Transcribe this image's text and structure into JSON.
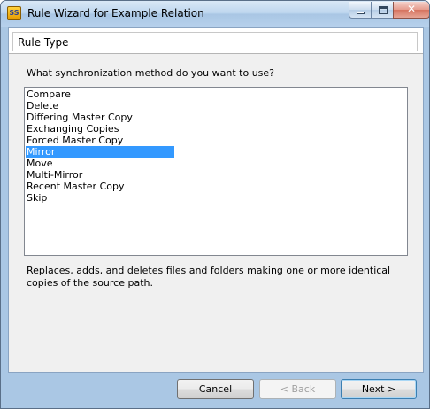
{
  "window": {
    "title": "Rule Wizard for Example Relation",
    "app_icon_text": "SS"
  },
  "header": {
    "title": "Rule Type"
  },
  "main": {
    "prompt": "What synchronization method do you want to use?",
    "methods": [
      "Compare",
      "Delete",
      "Differing Master Copy",
      "Exchanging Copies",
      "Forced Master Copy",
      "Mirror",
      "Move",
      "Multi-Mirror",
      "Recent Master Copy",
      "Skip"
    ],
    "selected_method": "Mirror",
    "description": "Replaces, adds, and deletes files and folders making one or more identical copies of the source path."
  },
  "footer": {
    "cancel_label": "Cancel",
    "back_label": "< Back",
    "next_label": "Next >"
  }
}
